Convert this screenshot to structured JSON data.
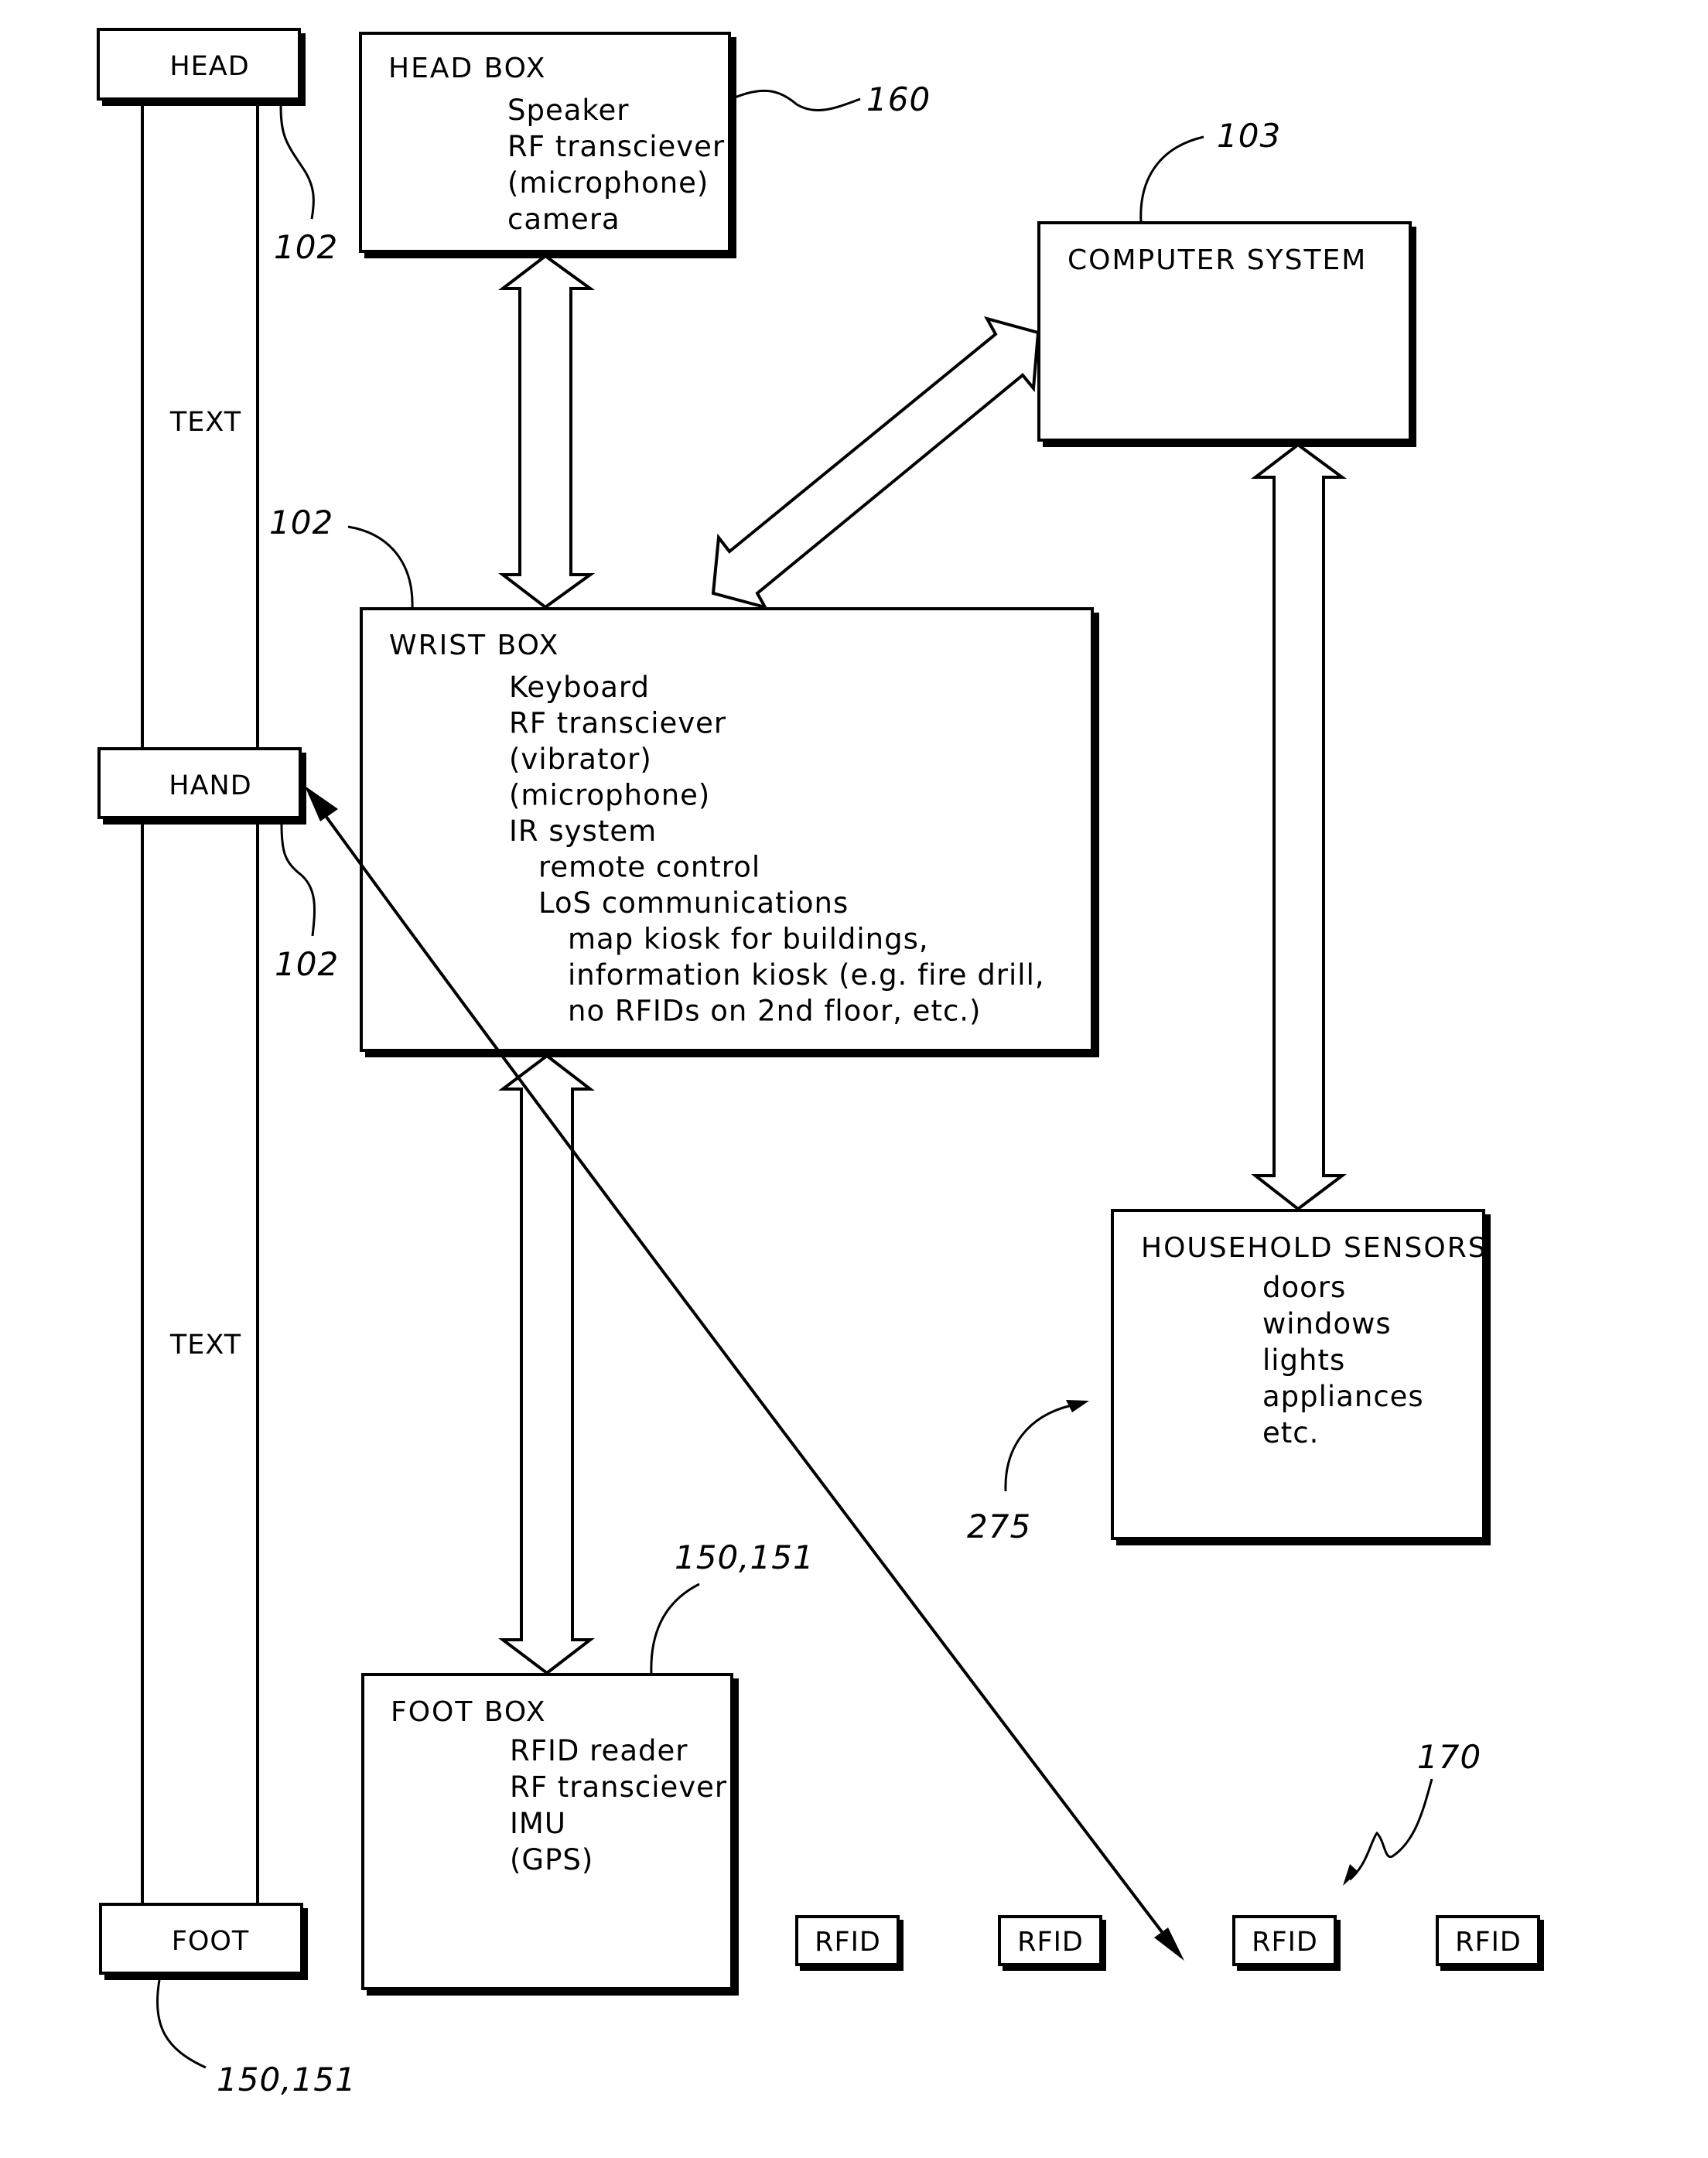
{
  "figure": {
    "body_strip": {
      "labels": {
        "head": "HEAD",
        "hand": "HAND",
        "foot": "FOOT"
      },
      "segment_text": [
        "TEXT",
        "TEXT"
      ],
      "refs": {
        "head": "102",
        "hand": "102",
        "foot": "150,151"
      }
    },
    "head_box": {
      "title": "HEAD BOX",
      "items": [
        "Speaker",
        "RF transciever",
        "(microphone)",
        "camera"
      ],
      "ref": "160"
    },
    "computer_system": {
      "title": "COMPUTER SYSTEM",
      "ref": "103"
    },
    "wrist_box": {
      "title": "WRIST BOX",
      "ref": "102",
      "items": [
        {
          "text": "Keyboard",
          "indent": 0
        },
        {
          "text": "RF transciever",
          "indent": 0
        },
        {
          "text": "(vibrator)",
          "indent": 0
        },
        {
          "text": "(microphone)",
          "indent": 0
        },
        {
          "text": "IR system",
          "indent": 0
        },
        {
          "text": "remote control",
          "indent": 1
        },
        {
          "text": "LoS communications",
          "indent": 1
        },
        {
          "text": "map kiosk for buildings,",
          "indent": 2
        },
        {
          "text": "information kiosk (e.g. fire drill,",
          "indent": 2
        },
        {
          "text": "no RFIDs on 2nd floor, etc.)",
          "indent": 2
        }
      ]
    },
    "household_sensors": {
      "title": "HOUSEHOLD SENSORS",
      "items": [
        "doors",
        "windows",
        "lights",
        "appliances",
        "etc."
      ],
      "ref": "275"
    },
    "foot_box": {
      "title": "FOOT BOX",
      "items": [
        "RFID reader",
        "RF transciever",
        "IMU",
        "(GPS)"
      ],
      "ref": "150,151"
    },
    "rfid_tags": {
      "labels": [
        "RFID",
        "RFID",
        "RFID",
        "RFID"
      ],
      "ref": "170"
    },
    "connections": [
      {
        "from": "head_box",
        "to": "wrist_box",
        "type": "bidirectional-block-arrow"
      },
      {
        "from": "wrist_box",
        "to": "computer_system",
        "type": "bidirectional-block-arrow"
      },
      {
        "from": "computer_system",
        "to": "household_sensors",
        "type": "bidirectional-block-arrow"
      },
      {
        "from": "wrist_box",
        "to": "foot_box",
        "type": "bidirectional-block-arrow"
      },
      {
        "from": "hand",
        "to": "rfid_tag_3",
        "type": "bidirectional-line-arrow"
      }
    ]
  }
}
